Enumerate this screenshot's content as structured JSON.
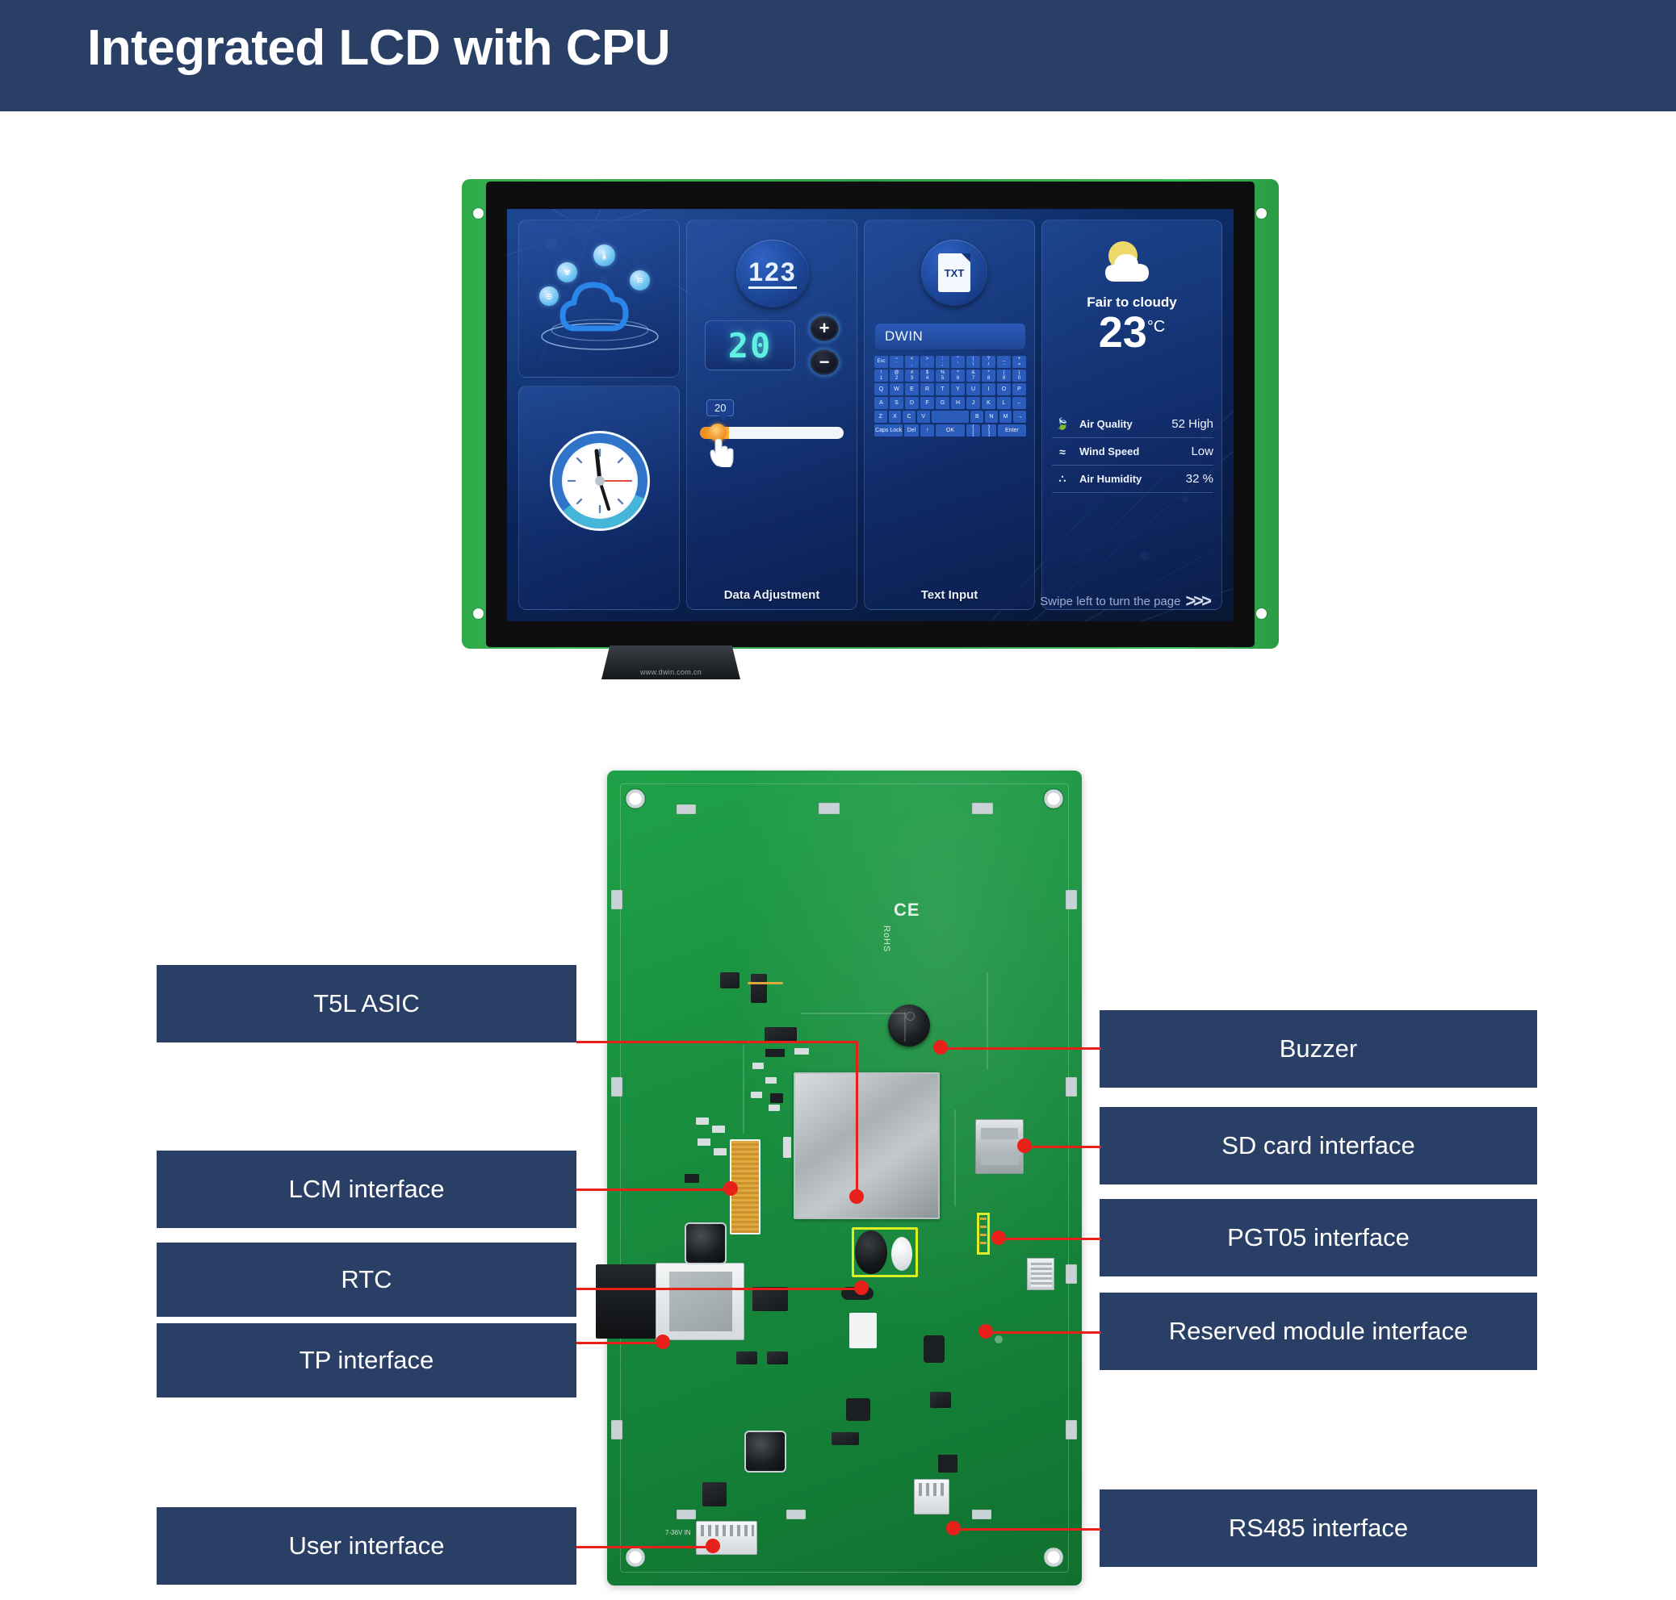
{
  "header": {
    "title": "Integrated LCD with CPU"
  },
  "lcd": {
    "panels": {
      "data_adjustment": {
        "label": "Data Adjustment",
        "numeric_button": "123",
        "value_display": "20",
        "plus": "+",
        "minus": "−",
        "slider_value": "20",
        "slider_percent": 20
      },
      "text_input": {
        "label": "Text Input",
        "field_value": "DWIN",
        "keyboard": [
          [
            "Esc",
            "~\n`",
            "<\n,",
            ">\n.",
            ":\n;",
            "\"\n'",
            "|\n\\",
            "?\n/",
            "_\n-",
            "+\n="
          ],
          [
            "!\n1",
            "@\n2",
            "#\n3",
            "$\n4",
            "%\n5",
            "^\n6",
            "&\n7",
            "*\n8",
            "(\n9",
            ")\n0"
          ],
          [
            "Q",
            "W",
            "E",
            "R",
            "T",
            "Y",
            "U",
            "I",
            "O",
            "P"
          ],
          [
            "A",
            "S",
            "D",
            "F",
            "G",
            "H",
            "J",
            "K",
            "L",
            "←"
          ],
          [
            "Z",
            "X",
            "C",
            "V",
            "",
            "B",
            "N",
            "M",
            "→"
          ],
          [
            "Caps Lock",
            "Del",
            "↑",
            "OK",
            "{\n[",
            "}\n]",
            "Enter"
          ]
        ]
      },
      "weather": {
        "condition": "Fair to cloudy",
        "temperature": "23",
        "temperature_unit": "°C",
        "rows": [
          {
            "icon": "leaf-icon",
            "label": "Air Quality",
            "value": "52 High"
          },
          {
            "icon": "wind-icon",
            "label": "Wind Speed",
            "value": "Low"
          },
          {
            "icon": "humidity-icon",
            "label": "Air Humidity",
            "value": "32 %"
          }
        ]
      },
      "cloud": {
        "icons": [
          "thermometer-icon",
          "fan-icon",
          "wifi-icon",
          "globe-icon",
          "cloud-icon"
        ]
      },
      "clock": {
        "icon": "analog-clock-icon"
      }
    },
    "swipe_hint": "Swipe left to turn the page",
    "swipe_chevrons": ">>>",
    "cable_text": "www.dwin.com.cn"
  },
  "pcb": {
    "silkscreen": {
      "ce": "CE",
      "rohs": "RoHS",
      "power_in": "7-36V IN"
    },
    "callouts_left": [
      {
        "id": "t5l-asic",
        "label": "T5L ASIC"
      },
      {
        "id": "lcm-interface",
        "label": "LCM interface"
      },
      {
        "id": "rtc",
        "label": "RTC"
      },
      {
        "id": "tp-interface",
        "label": "TP interface"
      },
      {
        "id": "user-interface",
        "label": "User interface"
      }
    ],
    "callouts_right": [
      {
        "id": "buzzer",
        "label": "Buzzer"
      },
      {
        "id": "sd-card-interface",
        "label": "SD card interface"
      },
      {
        "id": "pgt05-interface",
        "label": "PGT05 interface"
      },
      {
        "id": "reserved-module-interface",
        "label": "Reserved module interface"
      },
      {
        "id": "rs485-interface",
        "label": "RS485 interface"
      }
    ]
  },
  "colors": {
    "brand_navy": "#2a3f66",
    "callout_line": "#e8201a",
    "pcb_green": "#19903f",
    "highlight_yellow": "#ddee22",
    "lcd_blue": "#0c2a63"
  }
}
